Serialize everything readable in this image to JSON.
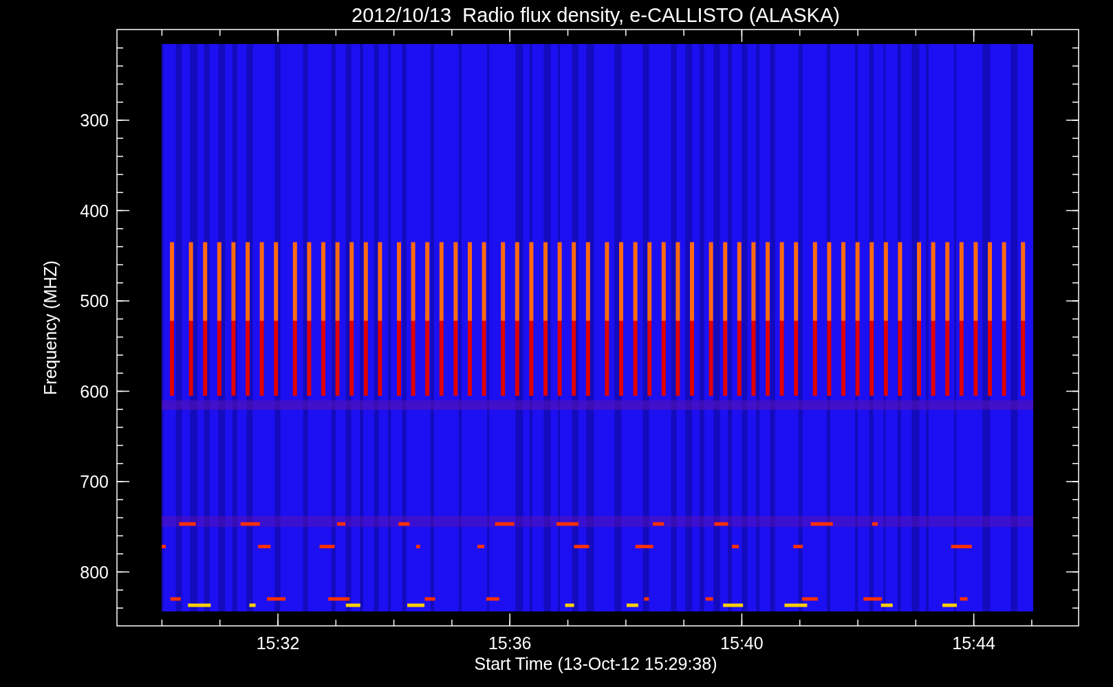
{
  "title": "2012/10/13  Radio flux density, e-CALLISTO (ALASKA)",
  "y_axis": {
    "label": "Frequency (MHZ)",
    "ticks": [
      "300",
      "400",
      "500",
      "600",
      "700",
      "800"
    ]
  },
  "x_axis": {
    "label": "Start Time (13-Oct-12 15:29:38)",
    "ticks": [
      "15:32",
      "15:36",
      "15:40",
      "15:44"
    ]
  }
}
